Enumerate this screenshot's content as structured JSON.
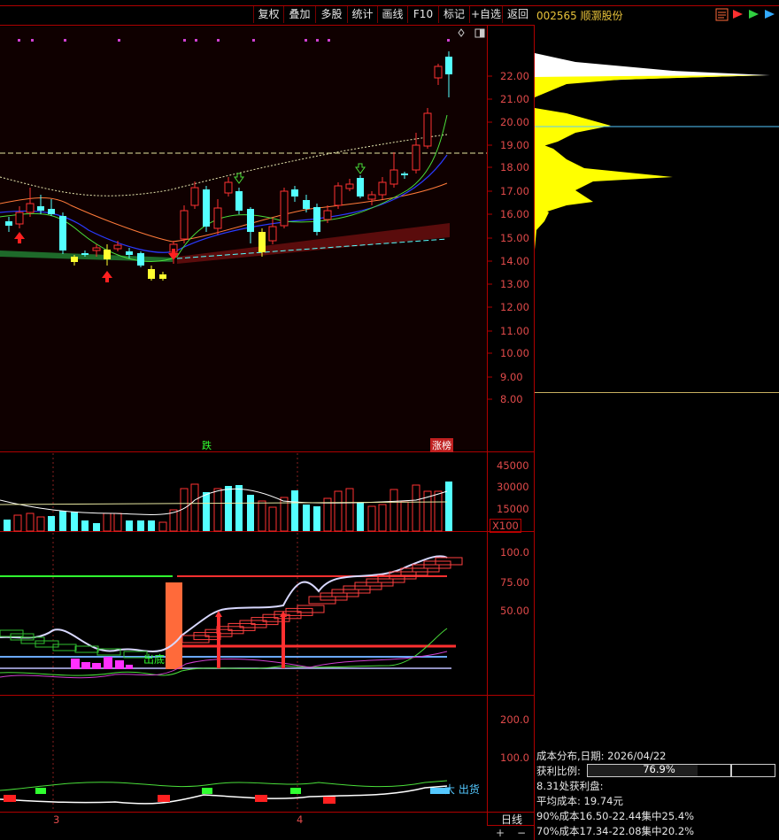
{
  "toolbar": {
    "buttons": [
      "复权",
      "叠加",
      "多股",
      "统计",
      "画线",
      "F10",
      "标记",
      "+自选",
      "返回"
    ]
  },
  "stock": {
    "code_name": "002565 顺灏股份"
  },
  "price_axis": {
    "labels": [
      "22.00",
      "21.00",
      "20.00",
      "19.00",
      "18.00",
      "17.00",
      "16.00",
      "15.00",
      "14.00",
      "13.00",
      "12.00",
      "11.00",
      "10.00",
      "9.00",
      "8.00"
    ]
  },
  "volume_axis": {
    "labels": [
      "45000",
      "30000",
      "15000"
    ],
    "unit": "X100"
  },
  "indicator_axis": {
    "labels": [
      "100.0",
      "75.00",
      "50.00"
    ]
  },
  "indicator2_axis": {
    "labels": [
      "200.0",
      "100.0"
    ]
  },
  "chart_tags": {
    "die": "跌",
    "zhangbang": "涨榜",
    "chudi": "出底",
    "dachu": "大 出货"
  },
  "x_axis": {
    "labels": [
      "3",
      "4"
    ]
  },
  "cost_panel": {
    "title": "成本分布,日期: 2026/04/22",
    "profit_label": "获利比例:",
    "profit_value": "76.9%",
    "profit_ratio": 0.769,
    "line1": "8.31处获利盘:",
    "line2": "平均成本: 19.74元",
    "line3": "90%成本16.50-22.44集中25.4%",
    "line4": "70%成本17.34-22.08集中20.2%"
  },
  "period": {
    "label": "日线",
    "plus": "+",
    "minus": "−"
  },
  "colors": {
    "up": "#ff3232",
    "down": "#54ffff",
    "bg": "#000000",
    "grid": "#b00000",
    "chip": "#ffff00"
  }
}
